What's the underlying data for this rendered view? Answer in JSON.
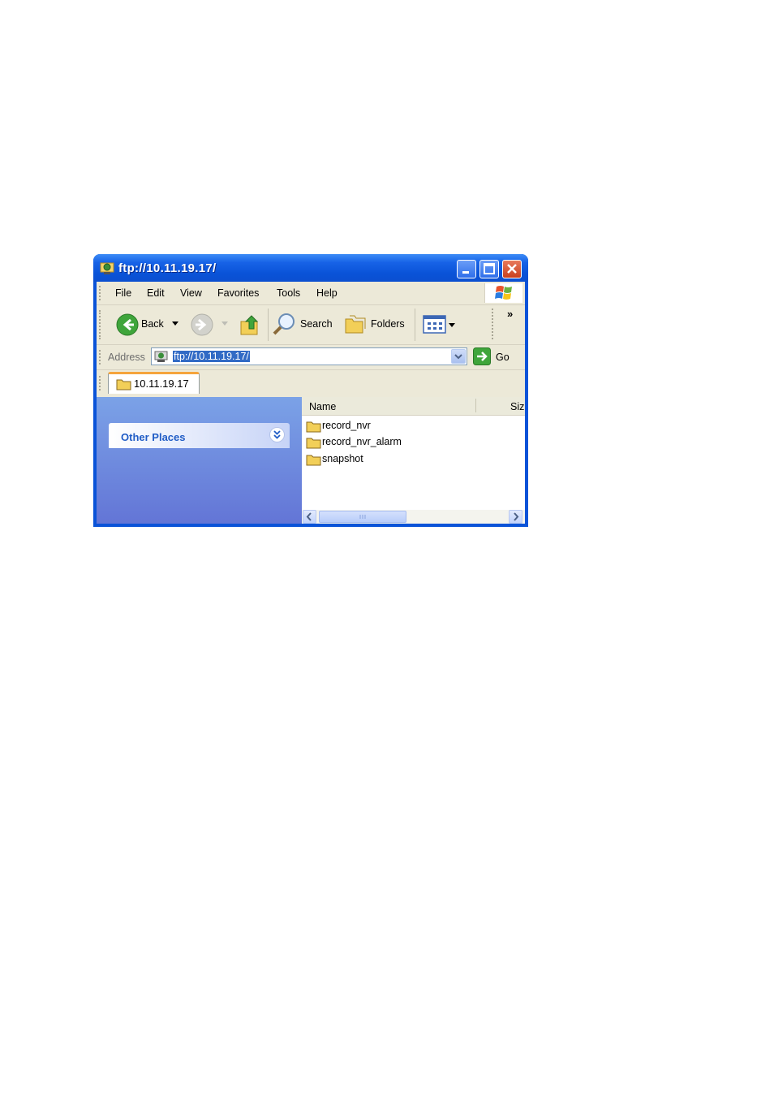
{
  "window": {
    "title": "ftp://10.11.19.17/"
  },
  "menu": {
    "items": [
      "File",
      "Edit",
      "View",
      "Favorites",
      "Tools",
      "Help"
    ]
  },
  "toolbar": {
    "back_label": "Back",
    "search_label": "Search",
    "folders_label": "Folders",
    "chevron": "»"
  },
  "address": {
    "label": "Address",
    "value": "ftp://10.11.19.17/",
    "go_label": "Go"
  },
  "tabs": [
    {
      "label": "10.11.19.17"
    }
  ],
  "taskpane": {
    "other_places_label": "Other Places"
  },
  "list": {
    "columns": [
      "Name",
      "Siz"
    ],
    "items": [
      {
        "name": "record_nvr",
        "icon": "folder-icon"
      },
      {
        "name": "record_nvr_alarm",
        "icon": "folder-icon"
      },
      {
        "name": "snapshot",
        "icon": "folder-icon"
      }
    ]
  },
  "colors": {
    "titlebar": "#0a53d8",
    "taskpane": "#7ba2e7",
    "selection": "#316ac5"
  }
}
